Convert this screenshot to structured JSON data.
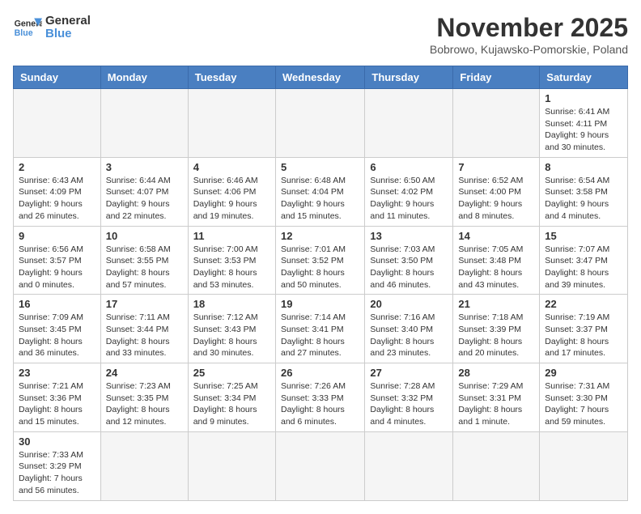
{
  "header": {
    "logo_general": "General",
    "logo_blue": "Blue",
    "month": "November 2025",
    "location": "Bobrowo, Kujawsko-Pomorskie, Poland"
  },
  "weekdays": [
    "Sunday",
    "Monday",
    "Tuesday",
    "Wednesday",
    "Thursday",
    "Friday",
    "Saturday"
  ],
  "weeks": [
    [
      {
        "day": "",
        "info": ""
      },
      {
        "day": "",
        "info": ""
      },
      {
        "day": "",
        "info": ""
      },
      {
        "day": "",
        "info": ""
      },
      {
        "day": "",
        "info": ""
      },
      {
        "day": "",
        "info": ""
      },
      {
        "day": "1",
        "info": "Sunrise: 6:41 AM\nSunset: 4:11 PM\nDaylight: 9 hours and 30 minutes."
      }
    ],
    [
      {
        "day": "2",
        "info": "Sunrise: 6:43 AM\nSunset: 4:09 PM\nDaylight: 9 hours and 26 minutes."
      },
      {
        "day": "3",
        "info": "Sunrise: 6:44 AM\nSunset: 4:07 PM\nDaylight: 9 hours and 22 minutes."
      },
      {
        "day": "4",
        "info": "Sunrise: 6:46 AM\nSunset: 4:06 PM\nDaylight: 9 hours and 19 minutes."
      },
      {
        "day": "5",
        "info": "Sunrise: 6:48 AM\nSunset: 4:04 PM\nDaylight: 9 hours and 15 minutes."
      },
      {
        "day": "6",
        "info": "Sunrise: 6:50 AM\nSunset: 4:02 PM\nDaylight: 9 hours and 11 minutes."
      },
      {
        "day": "7",
        "info": "Sunrise: 6:52 AM\nSunset: 4:00 PM\nDaylight: 9 hours and 8 minutes."
      },
      {
        "day": "8",
        "info": "Sunrise: 6:54 AM\nSunset: 3:58 PM\nDaylight: 9 hours and 4 minutes."
      }
    ],
    [
      {
        "day": "9",
        "info": "Sunrise: 6:56 AM\nSunset: 3:57 PM\nDaylight: 9 hours and 0 minutes."
      },
      {
        "day": "10",
        "info": "Sunrise: 6:58 AM\nSunset: 3:55 PM\nDaylight: 8 hours and 57 minutes."
      },
      {
        "day": "11",
        "info": "Sunrise: 7:00 AM\nSunset: 3:53 PM\nDaylight: 8 hours and 53 minutes."
      },
      {
        "day": "12",
        "info": "Sunrise: 7:01 AM\nSunset: 3:52 PM\nDaylight: 8 hours and 50 minutes."
      },
      {
        "day": "13",
        "info": "Sunrise: 7:03 AM\nSunset: 3:50 PM\nDaylight: 8 hours and 46 minutes."
      },
      {
        "day": "14",
        "info": "Sunrise: 7:05 AM\nSunset: 3:48 PM\nDaylight: 8 hours and 43 minutes."
      },
      {
        "day": "15",
        "info": "Sunrise: 7:07 AM\nSunset: 3:47 PM\nDaylight: 8 hours and 39 minutes."
      }
    ],
    [
      {
        "day": "16",
        "info": "Sunrise: 7:09 AM\nSunset: 3:45 PM\nDaylight: 8 hours and 36 minutes."
      },
      {
        "day": "17",
        "info": "Sunrise: 7:11 AM\nSunset: 3:44 PM\nDaylight: 8 hours and 33 minutes."
      },
      {
        "day": "18",
        "info": "Sunrise: 7:12 AM\nSunset: 3:43 PM\nDaylight: 8 hours and 30 minutes."
      },
      {
        "day": "19",
        "info": "Sunrise: 7:14 AM\nSunset: 3:41 PM\nDaylight: 8 hours and 27 minutes."
      },
      {
        "day": "20",
        "info": "Sunrise: 7:16 AM\nSunset: 3:40 PM\nDaylight: 8 hours and 23 minutes."
      },
      {
        "day": "21",
        "info": "Sunrise: 7:18 AM\nSunset: 3:39 PM\nDaylight: 8 hours and 20 minutes."
      },
      {
        "day": "22",
        "info": "Sunrise: 7:19 AM\nSunset: 3:37 PM\nDaylight: 8 hours and 17 minutes."
      }
    ],
    [
      {
        "day": "23",
        "info": "Sunrise: 7:21 AM\nSunset: 3:36 PM\nDaylight: 8 hours and 15 minutes."
      },
      {
        "day": "24",
        "info": "Sunrise: 7:23 AM\nSunset: 3:35 PM\nDaylight: 8 hours and 12 minutes."
      },
      {
        "day": "25",
        "info": "Sunrise: 7:25 AM\nSunset: 3:34 PM\nDaylight: 8 hours and 9 minutes."
      },
      {
        "day": "26",
        "info": "Sunrise: 7:26 AM\nSunset: 3:33 PM\nDaylight: 8 hours and 6 minutes."
      },
      {
        "day": "27",
        "info": "Sunrise: 7:28 AM\nSunset: 3:32 PM\nDaylight: 8 hours and 4 minutes."
      },
      {
        "day": "28",
        "info": "Sunrise: 7:29 AM\nSunset: 3:31 PM\nDaylight: 8 hours and 1 minute."
      },
      {
        "day": "29",
        "info": "Sunrise: 7:31 AM\nSunset: 3:30 PM\nDaylight: 7 hours and 59 minutes."
      }
    ],
    [
      {
        "day": "30",
        "info": "Sunrise: 7:33 AM\nSunset: 3:29 PM\nDaylight: 7 hours and 56 minutes."
      },
      {
        "day": "",
        "info": ""
      },
      {
        "day": "",
        "info": ""
      },
      {
        "day": "",
        "info": ""
      },
      {
        "day": "",
        "info": ""
      },
      {
        "day": "",
        "info": ""
      },
      {
        "day": "",
        "info": ""
      }
    ]
  ]
}
